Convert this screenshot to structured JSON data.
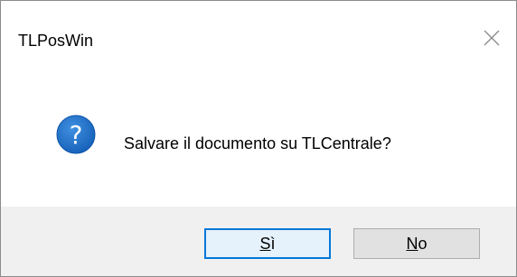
{
  "window": {
    "title": "TLPosWin",
    "close_label": "✕"
  },
  "icon": {
    "name": "question-icon",
    "glyph": "?",
    "color": "#1a6fc6"
  },
  "message": {
    "text": "Salvare il documento su TLCentrale?"
  },
  "buttons": {
    "yes": {
      "accel": "S",
      "rest": "ì",
      "label": "Sì",
      "default": true
    },
    "no": {
      "accel": "N",
      "rest": "o",
      "label": "No"
    }
  },
  "colors": {
    "accent": "#0078d7",
    "footer_bg": "#f0f0f0",
    "button_bg": "#e1e1e1"
  }
}
